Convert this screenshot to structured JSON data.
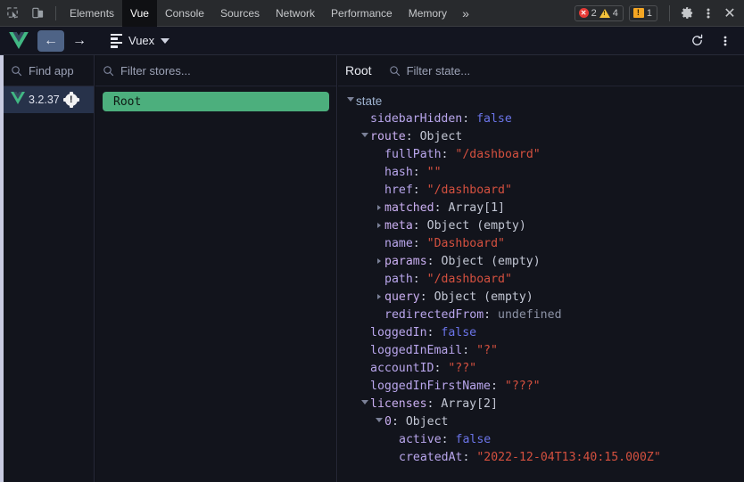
{
  "devtools": {
    "icons": {
      "inspect": "inspect-element-icon",
      "device": "device-toolbar-icon"
    },
    "tabs": [
      {
        "label": "Elements",
        "active": false
      },
      {
        "label": "Vue",
        "active": true
      },
      {
        "label": "Console",
        "active": false
      },
      {
        "label": "Sources",
        "active": false
      },
      {
        "label": "Network",
        "active": false
      },
      {
        "label": "Performance",
        "active": false
      },
      {
        "label": "Memory",
        "active": false
      }
    ],
    "more_label": "»",
    "counters": {
      "errors": "2",
      "warnings": "4",
      "messages": "1"
    },
    "settings_label": "gear-icon",
    "menu_label": "kebab-menu-icon",
    "close_label": "✕"
  },
  "vue_toolbar": {
    "logo": "vue-logo",
    "back_label": "←",
    "forward_label": "→",
    "inspector_name": "Vuex",
    "refresh_label": "⟳",
    "kebab_label": "kebab-menu-icon"
  },
  "apps_panel": {
    "search_placeholder": "Find app",
    "items": [
      {
        "version": "3.2.37",
        "badge": "!",
        "selected": true
      }
    ]
  },
  "stores_panel": {
    "search_placeholder": "Filter stores...",
    "items": [
      {
        "name": "Root",
        "selected": true
      }
    ]
  },
  "state_panel": {
    "title": "Root",
    "search_placeholder": "Filter state...",
    "tree": [
      {
        "depth": 0,
        "arrow": "open",
        "key": "state",
        "kind": "root",
        "value": "",
        "vtype": ""
      },
      {
        "depth": 1,
        "arrow": "none",
        "key": "sidebarHidden",
        "kind": "leaf",
        "value": "false",
        "vtype": "bool"
      },
      {
        "depth": 1,
        "arrow": "open",
        "key": "route",
        "kind": "obj",
        "value": "Object",
        "vtype": "type"
      },
      {
        "depth": 2,
        "arrow": "none",
        "key": "fullPath",
        "kind": "leaf",
        "value": "\"/dashboard\"",
        "vtype": "str"
      },
      {
        "depth": 2,
        "arrow": "none",
        "key": "hash",
        "kind": "leaf",
        "value": "\"\"",
        "vtype": "str"
      },
      {
        "depth": 2,
        "arrow": "none",
        "key": "href",
        "kind": "leaf",
        "value": "\"/dashboard\"",
        "vtype": "str"
      },
      {
        "depth": 2,
        "arrow": "closed",
        "key": "matched",
        "kind": "obj",
        "value": "Array[1]",
        "vtype": "type"
      },
      {
        "depth": 2,
        "arrow": "closed",
        "key": "meta",
        "kind": "obj",
        "value": "Object (empty)",
        "vtype": "type"
      },
      {
        "depth": 2,
        "arrow": "none",
        "key": "name",
        "kind": "leaf",
        "value": "\"Dashboard\"",
        "vtype": "str"
      },
      {
        "depth": 2,
        "arrow": "closed",
        "key": "params",
        "kind": "obj",
        "value": "Object (empty)",
        "vtype": "type"
      },
      {
        "depth": 2,
        "arrow": "none",
        "key": "path",
        "kind": "leaf",
        "value": "\"/dashboard\"",
        "vtype": "str"
      },
      {
        "depth": 2,
        "arrow": "closed",
        "key": "query",
        "kind": "obj",
        "value": "Object (empty)",
        "vtype": "type"
      },
      {
        "depth": 2,
        "arrow": "none",
        "key": "redirectedFrom",
        "kind": "leaf",
        "value": "undefined",
        "vtype": "undef"
      },
      {
        "depth": 1,
        "arrow": "none",
        "key": "loggedIn",
        "kind": "leaf",
        "value": "false",
        "vtype": "bool"
      },
      {
        "depth": 1,
        "arrow": "none",
        "key": "loggedInEmail",
        "kind": "leaf",
        "value": "\"?\"",
        "vtype": "str"
      },
      {
        "depth": 1,
        "arrow": "none",
        "key": "accountID",
        "kind": "leaf",
        "value": "\"??\"",
        "vtype": "str"
      },
      {
        "depth": 1,
        "arrow": "none",
        "key": "loggedInFirstName",
        "kind": "leaf",
        "value": "\"???\"",
        "vtype": "str"
      },
      {
        "depth": 1,
        "arrow": "open",
        "key": "licenses",
        "kind": "obj",
        "value": "Array[2]",
        "vtype": "type"
      },
      {
        "depth": 2,
        "arrow": "open",
        "key": "0",
        "kind": "obj",
        "value": "Object",
        "vtype": "type"
      },
      {
        "depth": 3,
        "arrow": "none",
        "key": "active",
        "kind": "leaf",
        "value": "false",
        "vtype": "bool"
      },
      {
        "depth": 3,
        "arrow": "none",
        "key": "createdAt",
        "kind": "leaf",
        "value": "\"2022-12-04T13:40:15.000Z\"",
        "vtype": "str"
      }
    ]
  },
  "colors": {
    "accent_green": "#4caf7d",
    "selection_blue": "#27324a",
    "string": "#d4503f",
    "boolean": "#6b74e8",
    "key": "#b9a6ec",
    "background": "#12141c"
  }
}
